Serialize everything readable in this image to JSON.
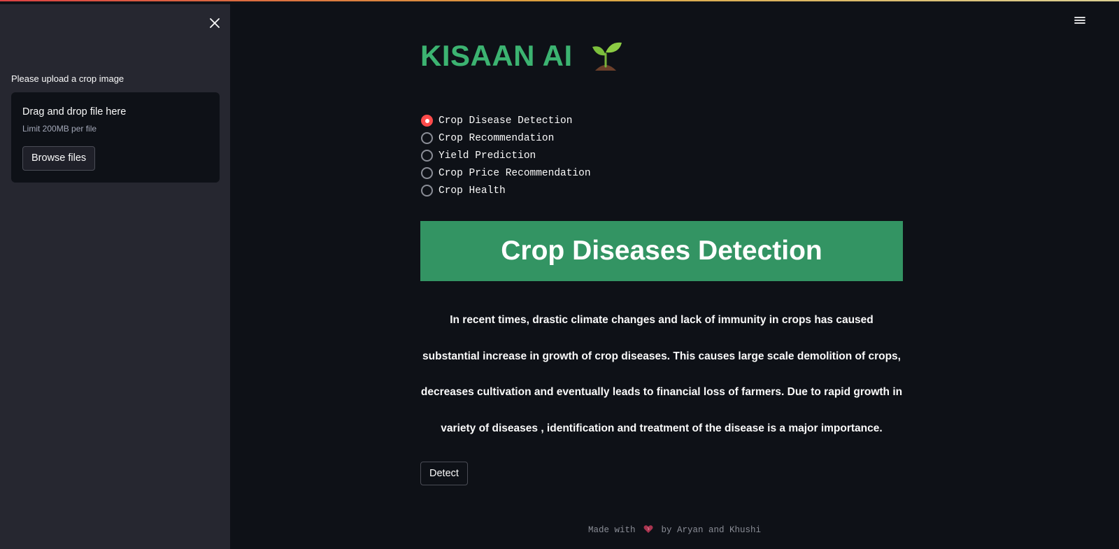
{
  "sidebar": {
    "close_icon": "close-icon",
    "upload_label": "Please upload a crop image",
    "dropzone": {
      "title": "Drag and drop file here",
      "limit": "Limit 200MB per file",
      "browse_label": "Browse files"
    }
  },
  "header": {
    "menu_icon": "hamburger-menu-icon"
  },
  "main": {
    "app_title": "KISAAN AI",
    "title_icon": "seedling-icon",
    "options": [
      {
        "label": "Crop Disease Detection",
        "selected": true
      },
      {
        "label": "Crop Recommendation",
        "selected": false
      },
      {
        "label": "Yield Prediction",
        "selected": false
      },
      {
        "label": "Crop Price Recommendation",
        "selected": false
      },
      {
        "label": "Crop Health",
        "selected": false
      }
    ],
    "banner_title": "Crop Diseases Detection",
    "description": "In recent times, drastic climate changes and lack of immunity in crops has caused substantial increase in growth of crop diseases. This causes large scale demolition of crops, decreases cultivation and eventually leads to financial loss of farmers. Due to rapid growth in variety of diseases , identification and treatment of the disease is a major importance.",
    "detect_label": "Detect"
  },
  "footer": {
    "prefix": "Made with",
    "heart_icon": "heart-icon",
    "suffix": "by Aryan and Khushi"
  },
  "colors": {
    "background": "#0e1117",
    "sidebar": "#262730",
    "title_green": "#3cb371",
    "banner_green": "#339463",
    "radio_selected": "#ff4b4b"
  }
}
